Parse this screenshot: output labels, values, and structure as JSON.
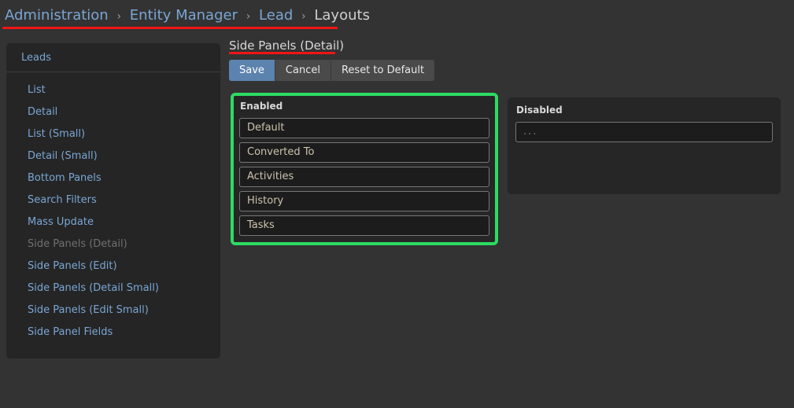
{
  "breadcrumb": {
    "items": [
      {
        "label": "Administration",
        "type": "link"
      },
      {
        "label": "Entity Manager",
        "type": "link"
      },
      {
        "label": "Lead",
        "type": "link"
      },
      {
        "label": "Layouts",
        "type": "current"
      }
    ],
    "separator": "›"
  },
  "sidebar": {
    "header": "Leads",
    "items": [
      {
        "label": "List",
        "active": false
      },
      {
        "label": "Detail",
        "active": false
      },
      {
        "label": "List (Small)",
        "active": false
      },
      {
        "label": "Detail (Small)",
        "active": false
      },
      {
        "label": "Bottom Panels",
        "active": false
      },
      {
        "label": "Search Filters",
        "active": false
      },
      {
        "label": "Mass Update",
        "active": false
      },
      {
        "label": "Side Panels (Detail)",
        "active": true
      },
      {
        "label": "Side Panels (Edit)",
        "active": false
      },
      {
        "label": "Side Panels (Detail Small)",
        "active": false
      },
      {
        "label": "Side Panels (Edit Small)",
        "active": false
      },
      {
        "label": "Side Panel Fields",
        "active": false
      }
    ]
  },
  "main": {
    "title": "Side Panels (Detail)",
    "buttons": {
      "save": "Save",
      "cancel": "Cancel",
      "reset": "Reset to Default"
    },
    "enabled_panel": {
      "title": "Enabled",
      "items": [
        "Default",
        "Converted To",
        "Activities",
        "History",
        "Tasks"
      ]
    },
    "disabled_panel": {
      "title": "Disabled",
      "placeholder": "..."
    }
  },
  "colors": {
    "page_background": "#333333",
    "panel_background": "#262626",
    "row_background": "#1c1c1c",
    "link": "#7aa6d4",
    "primary_button": "#5c83ad",
    "highlight_border": "#2ddb62",
    "annotation": "#f01515"
  }
}
